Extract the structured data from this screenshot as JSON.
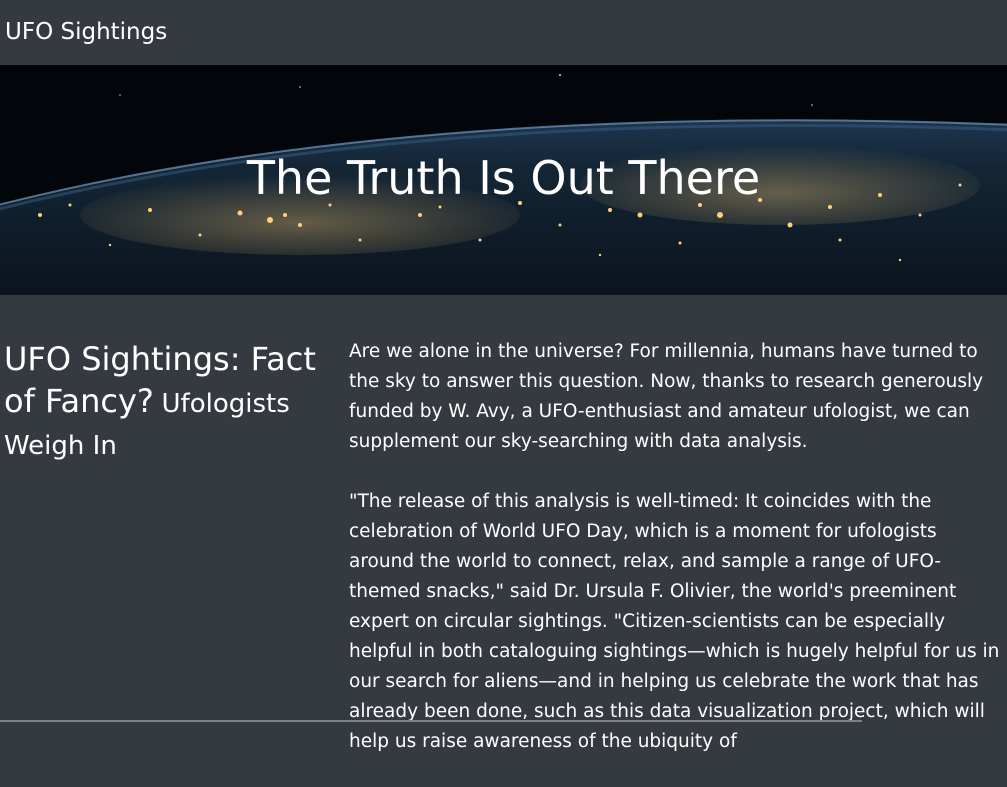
{
  "navbar": {
    "brand": "UFO Sightings"
  },
  "hero": {
    "title": "The Truth Is Out There"
  },
  "article": {
    "heading_main": "UFO Sightings: Fact of Fancy?",
    "heading_sub": "Ufologists Weigh In",
    "paragraphs": [
      "Are we alone in the universe? For millennia, humans have turned to the sky to answer this question. Now, thanks to research generously funded by W. Avy, a UFO-enthusiast and amateur ufologist, we can supplement our sky-searching with data analysis.",
      "\"The release of this analysis is well-timed: It coincides with the celebration of World UFO Day, which is a moment for ufologists around the world to connect, relax, and sample a range of UFO-themed snacks,\" said Dr. Ursula F. Olivier, the world's preeminent expert on circular sightings. \"Citizen-scientists can be especially helpful in both cataloguing sightings—which is hugely helpful for us in our search for aliens—and in helping us celebrate the work that has already been done, such as this data visualization project, which will help us raise awareness of the ubiquity of"
    ]
  },
  "colors": {
    "page_background": "#353a40",
    "text": "#ffffff",
    "city_lights": "#ffd27a"
  }
}
